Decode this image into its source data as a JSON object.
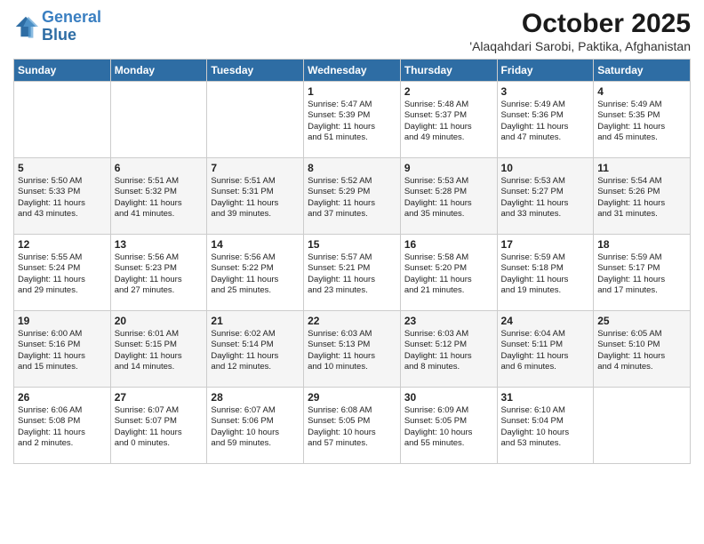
{
  "header": {
    "logo_line1": "General",
    "logo_line2": "Blue",
    "title": "October 2025",
    "subtitle": "'Alaqahdari Sarobi, Paktika, Afghanistan"
  },
  "weekdays": [
    "Sunday",
    "Monday",
    "Tuesday",
    "Wednesday",
    "Thursday",
    "Friday",
    "Saturday"
  ],
  "weeks": [
    [
      {
        "day": "",
        "text": ""
      },
      {
        "day": "",
        "text": ""
      },
      {
        "day": "",
        "text": ""
      },
      {
        "day": "1",
        "text": "Sunrise: 5:47 AM\nSunset: 5:39 PM\nDaylight: 11 hours\nand 51 minutes."
      },
      {
        "day": "2",
        "text": "Sunrise: 5:48 AM\nSunset: 5:37 PM\nDaylight: 11 hours\nand 49 minutes."
      },
      {
        "day": "3",
        "text": "Sunrise: 5:49 AM\nSunset: 5:36 PM\nDaylight: 11 hours\nand 47 minutes."
      },
      {
        "day": "4",
        "text": "Sunrise: 5:49 AM\nSunset: 5:35 PM\nDaylight: 11 hours\nand 45 minutes."
      }
    ],
    [
      {
        "day": "5",
        "text": "Sunrise: 5:50 AM\nSunset: 5:33 PM\nDaylight: 11 hours\nand 43 minutes."
      },
      {
        "day": "6",
        "text": "Sunrise: 5:51 AM\nSunset: 5:32 PM\nDaylight: 11 hours\nand 41 minutes."
      },
      {
        "day": "7",
        "text": "Sunrise: 5:51 AM\nSunset: 5:31 PM\nDaylight: 11 hours\nand 39 minutes."
      },
      {
        "day": "8",
        "text": "Sunrise: 5:52 AM\nSunset: 5:29 PM\nDaylight: 11 hours\nand 37 minutes."
      },
      {
        "day": "9",
        "text": "Sunrise: 5:53 AM\nSunset: 5:28 PM\nDaylight: 11 hours\nand 35 minutes."
      },
      {
        "day": "10",
        "text": "Sunrise: 5:53 AM\nSunset: 5:27 PM\nDaylight: 11 hours\nand 33 minutes."
      },
      {
        "day": "11",
        "text": "Sunrise: 5:54 AM\nSunset: 5:26 PM\nDaylight: 11 hours\nand 31 minutes."
      }
    ],
    [
      {
        "day": "12",
        "text": "Sunrise: 5:55 AM\nSunset: 5:24 PM\nDaylight: 11 hours\nand 29 minutes."
      },
      {
        "day": "13",
        "text": "Sunrise: 5:56 AM\nSunset: 5:23 PM\nDaylight: 11 hours\nand 27 minutes."
      },
      {
        "day": "14",
        "text": "Sunrise: 5:56 AM\nSunset: 5:22 PM\nDaylight: 11 hours\nand 25 minutes."
      },
      {
        "day": "15",
        "text": "Sunrise: 5:57 AM\nSunset: 5:21 PM\nDaylight: 11 hours\nand 23 minutes."
      },
      {
        "day": "16",
        "text": "Sunrise: 5:58 AM\nSunset: 5:20 PM\nDaylight: 11 hours\nand 21 minutes."
      },
      {
        "day": "17",
        "text": "Sunrise: 5:59 AM\nSunset: 5:18 PM\nDaylight: 11 hours\nand 19 minutes."
      },
      {
        "day": "18",
        "text": "Sunrise: 5:59 AM\nSunset: 5:17 PM\nDaylight: 11 hours\nand 17 minutes."
      }
    ],
    [
      {
        "day": "19",
        "text": "Sunrise: 6:00 AM\nSunset: 5:16 PM\nDaylight: 11 hours\nand 15 minutes."
      },
      {
        "day": "20",
        "text": "Sunrise: 6:01 AM\nSunset: 5:15 PM\nDaylight: 11 hours\nand 14 minutes."
      },
      {
        "day": "21",
        "text": "Sunrise: 6:02 AM\nSunset: 5:14 PM\nDaylight: 11 hours\nand 12 minutes."
      },
      {
        "day": "22",
        "text": "Sunrise: 6:03 AM\nSunset: 5:13 PM\nDaylight: 11 hours\nand 10 minutes."
      },
      {
        "day": "23",
        "text": "Sunrise: 6:03 AM\nSunset: 5:12 PM\nDaylight: 11 hours\nand 8 minutes."
      },
      {
        "day": "24",
        "text": "Sunrise: 6:04 AM\nSunset: 5:11 PM\nDaylight: 11 hours\nand 6 minutes."
      },
      {
        "day": "25",
        "text": "Sunrise: 6:05 AM\nSunset: 5:10 PM\nDaylight: 11 hours\nand 4 minutes."
      }
    ],
    [
      {
        "day": "26",
        "text": "Sunrise: 6:06 AM\nSunset: 5:08 PM\nDaylight: 11 hours\nand 2 minutes."
      },
      {
        "day": "27",
        "text": "Sunrise: 6:07 AM\nSunset: 5:07 PM\nDaylight: 11 hours\nand 0 minutes."
      },
      {
        "day": "28",
        "text": "Sunrise: 6:07 AM\nSunset: 5:06 PM\nDaylight: 10 hours\nand 59 minutes."
      },
      {
        "day": "29",
        "text": "Sunrise: 6:08 AM\nSunset: 5:05 PM\nDaylight: 10 hours\nand 57 minutes."
      },
      {
        "day": "30",
        "text": "Sunrise: 6:09 AM\nSunset: 5:05 PM\nDaylight: 10 hours\nand 55 minutes."
      },
      {
        "day": "31",
        "text": "Sunrise: 6:10 AM\nSunset: 5:04 PM\nDaylight: 10 hours\nand 53 minutes."
      },
      {
        "day": "",
        "text": ""
      }
    ]
  ]
}
